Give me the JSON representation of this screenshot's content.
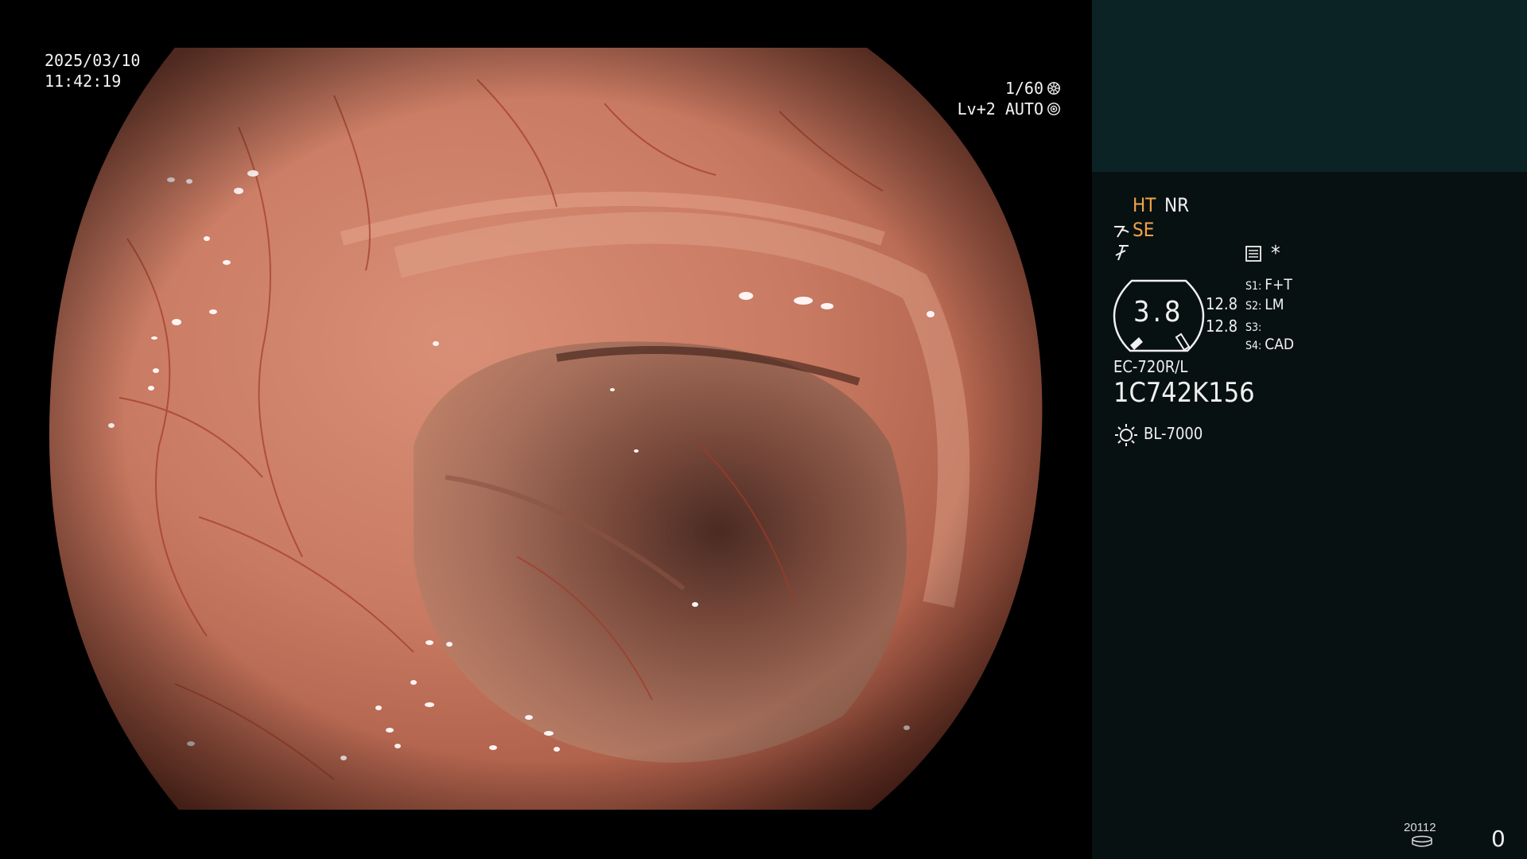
{
  "overlay": {
    "date": "2025/03/10",
    "time": "11:42:19",
    "shutter": "1/60",
    "brightness": "Lv+2 AUTO"
  },
  "panel": {
    "ht": "HT",
    "nr": "NR",
    "se": "SE",
    "star": "*",
    "dial_value": "3.8",
    "scale_1": "12.8",
    "scale_2": "12.8",
    "slots": [
      {
        "key": "S1:",
        "value": "F+T"
      },
      {
        "key": "S2:",
        "value": "LM"
      },
      {
        "key": "S3:",
        "value": ""
      },
      {
        "key": "S4:",
        "value": "CAD"
      }
    ],
    "scope_model": "EC-720R/L",
    "scope_serial": "1C742K156",
    "light_source": "BL-7000",
    "counter_label": "20112",
    "counter_value": "0"
  },
  "colors": {
    "panel_bg": "#081111",
    "panel_header": "#0c2326",
    "highlight_orange": "#f2a34a",
    "tissue": "#c27058"
  },
  "icons": [
    "shutter-gear-icon",
    "auto-gear-icon",
    "structure-enhance-icon",
    "sharpness-icon",
    "memo-icon",
    "light-source-icon",
    "disk-icon"
  ]
}
